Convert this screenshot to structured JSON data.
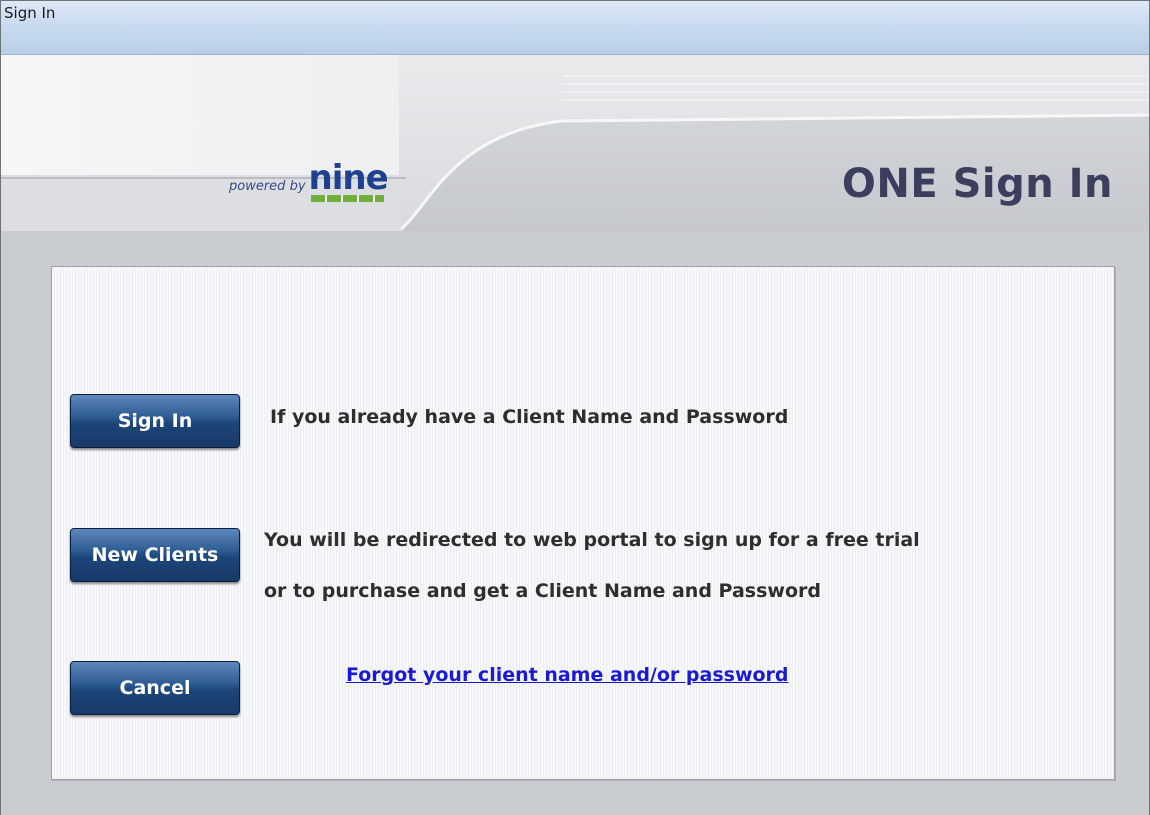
{
  "window": {
    "title": "Sign In"
  },
  "header": {
    "powered_by": "powered by",
    "brand": "nine",
    "title": "ONE Sign In"
  },
  "actions": {
    "sign_in": {
      "label": "Sign In",
      "description": "If you already have a Client Name and Password"
    },
    "new_clients": {
      "label": "New Clients",
      "description_line1": "You will be redirected to web portal to sign up for a free trial",
      "description_line2": "or to purchase and get a Client Name and Password"
    },
    "cancel": {
      "label": "Cancel"
    },
    "forgot_link": "Forgot your client name and/or password"
  },
  "colors": {
    "button": "#1c4579",
    "title": "#3c3e5e",
    "link": "#1a1ad6",
    "brand_green": "#6fb03a",
    "brand_blue": "#1f3f8f"
  }
}
